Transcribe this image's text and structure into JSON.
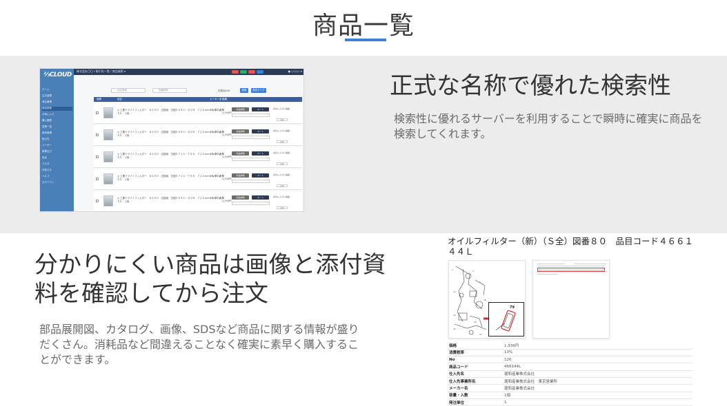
{
  "page": {
    "title": "商品一覧"
  },
  "section1": {
    "heading": "正式な名称で優れた検索性",
    "body": "検索性に優れるサーバーを利用することで瞬時に確実に商品を検索してくれます。"
  },
  "section2": {
    "heading": "分かりにくい商品は画像と添付資料を確認してから注文",
    "body": "部品展開図、カタログ、画像、SDSなど商品に関する情報が盛りだくさん。消耗品など間違えることなく確実に素早く購入することができます。"
  },
  "app_screenshot": {
    "logo": "⅔CLOUD",
    "topbar_text": "株式会社〇〇 / 取引先一覧 / 商品検索 ▾",
    "topbar_right": "● ◇◇◇◇ ▾",
    "pill_colors": [
      "#e15a5a",
      "#3aa66a",
      "#e15a5a",
      "#3f7fd6"
    ],
    "sidebar_items": [
      "ホーム",
      "注文管理",
      "発注管理",
      "商品検索",
      "お気に入り",
      "購入履歴",
      "見積一覧",
      "請求管理",
      "取引先",
      "ユーザー",
      "帳票出力",
      "設定",
      "マスタ",
      "お知らせ",
      "ヘルプ",
      "ログアウト"
    ],
    "search_placeholder_1": "品名検索",
    "search_placeholder_2": "品番検索",
    "check_label": "在庫品のみ",
    "search_button": "検索",
    "clear_button": "条件クリア",
    "headers": [
      "画像",
      "品名",
      "メーカー名",
      "価格"
    ],
    "row_button_detail": "商品詳細",
    "row_button_add": "カート",
    "row_cart_text": "お気に入りに追加",
    "row_small_button": "比較",
    "rows": [
      {
        "text": "◎ 工業ドラフトフィルター　Ｓ２００　交換用　交換Ｅ５４１－５２Ｈ　７１１ｍｍ×４５０×５０　１枚",
        "maker": "フルタニ産業",
        "price": "1,540円"
      },
      {
        "text": "◎ 工業ドラフトフィルター　Ｓ２００　交換用　交換Ｅ５４１－５２Ｈ　７１１ｍｍ×４５０×５０　１枚",
        "maker": "フルタニ産業",
        "price": "1,540円"
      },
      {
        "text": "◎ 工業ドラフトフィルター　Ｓ２００　交換用　交換Ｅ７１１－７５Ａ　７１１ｍｍ×４５０×５０　１枚",
        "maker": "フルタニ産業",
        "price": "1,540円"
      },
      {
        "text": "◎ 工業ドラフトフィルター　Ｓ２００　交換用　交換Ｅ７１１－７５Ａ　７１１ｍｍ×４５０×５０　１枚",
        "maker": "フルタニ産業",
        "price": "1,540円"
      },
      {
        "text": "◎ 工業ドラフトフィルター　Ｓ２００　交換用　交換Ｅ８４１－５２Ｈ　７１１ｍｍ×４５０×５０　１枚",
        "maker": "フルタニ産業",
        "price": "1,540円"
      }
    ]
  },
  "detail": {
    "title": "オイルフィルター（新）（Ｓ全）図番８０　品目コード４６６１４４Ｌ",
    "zoom_label": "79",
    "specs": [
      {
        "key": "価格",
        "value": "1,936円"
      },
      {
        "key": "消費税率",
        "value": "10%"
      },
      {
        "key": "No",
        "value": "126"
      },
      {
        "key": "商品コード",
        "value": "466144L"
      },
      {
        "key": "仕入先名",
        "value": "堀和産業株式会社"
      },
      {
        "key": "仕入先事業所名",
        "value": "堀和産業株式会社　東京営業所"
      },
      {
        "key": "メーカー名",
        "value": "堀和産業株式会社"
      },
      {
        "key": "容量・入数",
        "value": "1個"
      },
      {
        "key": "発注単位",
        "value": "1"
      }
    ]
  },
  "colors": {
    "accent": "#3f7fd6",
    "band": "#ececec",
    "sidebar": "#4a7fb8",
    "topbar": "#2b3a55"
  }
}
